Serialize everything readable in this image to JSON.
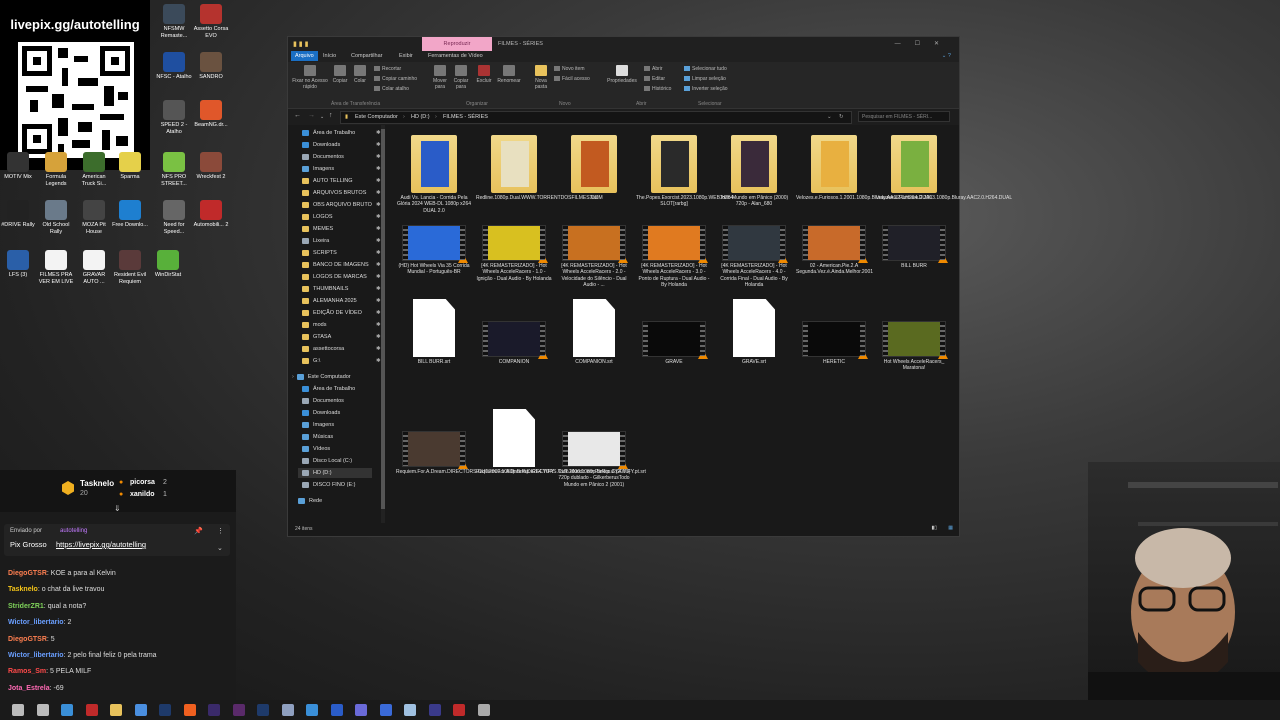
{
  "overlay": {
    "qr_title": "livepix.gg/autotelling"
  },
  "desktop_icons": [
    {
      "label": "NFSMW Remaste...",
      "color": "#3b4a5a"
    },
    {
      "label": "Assetto Corsa EVO",
      "color": "#b5332e"
    },
    {
      "label": "NFSC - Atalho",
      "color": "#1f4fa0"
    },
    {
      "label": "SANDRO",
      "color": "#6a5240"
    },
    {
      "label": "SPEED 2 - Atalho",
      "color": "#555"
    },
    {
      "label": "BeamNG.dr...",
      "color": "#e0572a"
    },
    {
      "label": "MOTIV Mix",
      "color": "#333"
    },
    {
      "label": "Formula Legends",
      "color": "#d6a23a"
    },
    {
      "label": "American Truck Si...",
      "color": "#3c6d2c"
    },
    {
      "label": "Sparma",
      "color": "#e5d04a"
    },
    {
      "label": "NFS PRO STREET...",
      "color": "#7ac143"
    },
    {
      "label": "Wreckfest 2",
      "color": "#8b4a3a"
    },
    {
      "label": "#DRIVE Rally",
      "color": "#222"
    },
    {
      "label": "Old School Rally",
      "color": "#6a7a8a"
    },
    {
      "label": "MOZA Pit House",
      "color": "#444"
    },
    {
      "label": "Free Downlo...",
      "color": "#1e7fd0"
    },
    {
      "label": "Need for Speed...",
      "color": "#666"
    },
    {
      "label": "Automobili... 2",
      "color": "#c02a2a"
    },
    {
      "label": "LFS (3)",
      "color": "#2a5fa8"
    },
    {
      "label": "FILMES PRA VER EM LIVE",
      "color": "#f3f3f3"
    },
    {
      "label": "GRAVAR AUTO ...",
      "color": "#f3f3f3"
    },
    {
      "label": "Resident Evil Requiem",
      "color": "#5a3a3a"
    },
    {
      "label": "WinDirStat",
      "color": "#58b03a"
    }
  ],
  "explorer": {
    "context_tab": "Reproduzir",
    "title": "FILMES - SÉRIES",
    "window_controls": [
      "—",
      "☐",
      "✕"
    ],
    "ribbon_tabs": [
      "Arquivo",
      "Início",
      "Compartilhar",
      "Exibir",
      "Ferramentas de Vídeo"
    ],
    "ribbon": {
      "pin": "Fixar no Acesso rápido",
      "copy": "Copiar",
      "paste": "Colar",
      "cut": "Recortar",
      "copy_path": "Copiar caminho",
      "paste_shortcut": "Colar atalho",
      "group_clipboard": "Área de Transferência",
      "move_to": "Mover para",
      "copy_to": "Copiar para",
      "delete": "Excluir",
      "rename": "Renomear",
      "group_organize": "Organizar",
      "new_folder": "Nova pasta",
      "new_item": "Novo item",
      "easy_access": "Fácil acesso",
      "group_new": "Novo",
      "properties": "Propriedades",
      "open": "Abrir",
      "edit": "Editar",
      "history": "Histórico",
      "group_open": "Abrir",
      "select_all": "Selecionar tudo",
      "select_none": "Limpar seleção",
      "invert": "Inverter seleção",
      "group_select": "Selecionar"
    },
    "breadcrumb": [
      "Este Computador",
      "HD (D:)",
      "FILMES - SÉRIES"
    ],
    "search_placeholder": "Pesquisar em FILMES - SÉRI...",
    "nav_items": [
      {
        "label": "Área de Trabalho",
        "color": "#3a8fd8",
        "pin": true
      },
      {
        "label": "Downloads",
        "color": "#3a8fd8",
        "pin": true
      },
      {
        "label": "Documentos",
        "color": "#9aa7b5",
        "pin": true
      },
      {
        "label": "Imagens",
        "color": "#5aa0d8",
        "pin": true
      },
      {
        "label": "AUTO TELLING",
        "color": "#e8c25c",
        "pin": true
      },
      {
        "label": "ARQUIVOS BRUTOS",
        "color": "#e8c25c",
        "pin": true
      },
      {
        "label": "OBS ARQUIVO BRUTO",
        "color": "#e8c25c",
        "pin": true
      },
      {
        "label": "LOGOS",
        "color": "#e8c25c",
        "pin": true
      },
      {
        "label": "MEMES",
        "color": "#e8c25c",
        "pin": true
      },
      {
        "label": "Lixeira",
        "color": "#9aa7b5",
        "pin": true
      },
      {
        "label": "SCRIPTS",
        "color": "#e8c25c",
        "pin": true
      },
      {
        "label": "BANCO DE IMAGENS",
        "color": "#e8c25c",
        "pin": true
      },
      {
        "label": "LOGOS DE MARCAS",
        "color": "#e8c25c",
        "pin": true
      },
      {
        "label": "THUMBNAILS",
        "color": "#e8c25c",
        "pin": true
      },
      {
        "label": "ALEMANHA 2025",
        "color": "#e8c25c",
        "pin": true
      },
      {
        "label": "EDIÇÃO DE VÍDEO",
        "color": "#e8c25c",
        "pin": true
      },
      {
        "label": "mods",
        "color": "#e8c25c",
        "pin": true
      },
      {
        "label": "GTASA",
        "color": "#e8c25c",
        "pin": true
      },
      {
        "label": "assettocorsa",
        "color": "#e8c25c",
        "pin": true
      },
      {
        "label": "G:\\",
        "color": "#e8c25c",
        "pin": true
      }
    ],
    "nav_pc": "Este Computador",
    "nav_pc_items": [
      {
        "label": "Área de Trabalho",
        "color": "#3a8fd8"
      },
      {
        "label": "Documentos",
        "color": "#9aa7b5"
      },
      {
        "label": "Downloads",
        "color": "#3a8fd8"
      },
      {
        "label": "Imagens",
        "color": "#5aa0d8"
      },
      {
        "label": "Músicas",
        "color": "#5aa0d8"
      },
      {
        "label": "Vídeos",
        "color": "#5aa0d8"
      },
      {
        "label": "Disco Local (C:)",
        "color": "#9aa7b5"
      },
      {
        "label": "HD (D:)",
        "color": "#9aa7b5"
      },
      {
        "label": "DISCO FINO (E:)",
        "color": "#9aa7b5"
      }
    ],
    "nav_network": "Rede",
    "items": [
      {
        "type": "folder",
        "name": "Audi Vs. Lancia - Corrida Pela Glória 2024 WEB-DL 1080p x264 DUAL 2.0",
        "color": "#2a5cc8"
      },
      {
        "type": "folder",
        "name": "Redline.1080p.Dual.WWW.TORRENTDOSFILMES.COM",
        "color": "#e8e0c0"
      },
      {
        "type": "folder",
        "name": "Taxi",
        "color": "#c25a20"
      },
      {
        "type": "folder",
        "name": "The.Popes.Exorcist.2023.1080p.WEB.H264-SLOT[rarbg]",
        "color": "#2a2a2a"
      },
      {
        "type": "folder",
        "name": "Todo Mundo em Pânico (2000) 720p - Alan_680",
        "color": "#3a2a3a"
      },
      {
        "type": "folder",
        "name": "Velozes.e.Furiosos.1.2001.1080p.Bluray.AAC2.0.H264.DUAL",
        "color": "#e8b040"
      },
      {
        "type": "folder",
        "name": "Velozes.e.Furiosos.2.2003.1080p.Bluray.AAC2.0.H264.DUAL",
        "color": "#7ab040"
      },
      {
        "type": "video",
        "name": "(HD) Hot Wheels Via 35 Corrida Mundial - Português-BR",
        "color": "#2a6ad8"
      },
      {
        "type": "video",
        "name": "[4K REMASTERIZADO] - Hot Wheels AcceleRacers - 1.0 - Ignição - Dual Audio - By Holanda",
        "color": "#d8c020"
      },
      {
        "type": "video",
        "name": "[4K REMASTERIZADO] - Hot Wheels AcceleRacers - 2.0 - Velocidade do Silêncio - Dual Audio - ...",
        "color": "#c87020"
      },
      {
        "type": "video",
        "name": "[4K REMASTERIZADO] - Hot Wheels AcceleRacers - 3.0 - Ponto de Ruptura - Dual Audio - By Holanda",
        "color": "#e07a20"
      },
      {
        "type": "video",
        "name": "[4K REMASTERIZADO] - Hot Wheels AcceleRacers - 4.0 - Corrida Final - Dual Audio - By Holanda",
        "color": "#303840"
      },
      {
        "type": "video",
        "name": "02 - American.Pie.2.A Segunda.Vez.é.Ainda.Melhor.2001",
        "color": "#c86a2a"
      },
      {
        "type": "video",
        "name": "BILL BURR",
        "color": "#202028"
      },
      {
        "type": "doc",
        "name": "BILL BURR.srt"
      },
      {
        "type": "video",
        "name": "COMPANION",
        "color": "#1a1a2a"
      },
      {
        "type": "doc",
        "name": "COMPANION.srt"
      },
      {
        "type": "video",
        "name": "GRAVE",
        "color": "#0a0a0a"
      },
      {
        "type": "doc",
        "name": "GRAVE.srt"
      },
      {
        "type": "video",
        "name": "HERETIC",
        "color": "#0a0a0a"
      },
      {
        "type": "video",
        "name": "Hot Wheels AcceleRacers_ Maratona!",
        "color": "#5a6a20"
      },
      {
        "type": "video",
        "name": "Requiem.For.A.Dream.DIRECTORS.CUT.2000.1080p.BrRip.x264.YIFY",
        "color": "#4a3a30"
      },
      {
        "type": "doc",
        "name": "Requiem.For.A.Dream.DIRECTORS.CUT.2000.1080p.BrRip.x264.YIFY.pt.srt"
      },
      {
        "type": "video",
        "name": "Todo Mundo em Panico 2 (2001) 720p dublado - GilkerberusTodo Mundo em Pânico 2 (2001)",
        "color": "#e8e8e8"
      }
    ],
    "status": "24 itens"
  },
  "stream_panel": {
    "user1": "Tasknelo",
    "user1_points": "20",
    "user2": "picorsa",
    "user2_points": "2",
    "user3": "xanildo",
    "user3_points": "1",
    "pinned_label": "Enviado por",
    "pinned_user": "autotelling",
    "pinned_text_prefix": "Pix Grosso",
    "pinned_link": "https://livepix.gg/autotelling",
    "chat": [
      {
        "user": "DiegoGTSR",
        "color": "#ff7f50",
        "text": "KOE a para al Kelvin"
      },
      {
        "user": "Tasknelo",
        "color": "#f5c518",
        "text": "o chat da live travou"
      },
      {
        "user": "StriderZR1",
        "color": "#7fd35a",
        "text": "qual a nota?"
      },
      {
        "user": "Wictor_libertario",
        "color": "#6a9fff",
        "text": "2"
      },
      {
        "user": "DiegoGTSR",
        "color": "#ff7f50",
        "text": "5"
      },
      {
        "user": "Wictor_libertario",
        "color": "#6a9fff",
        "text": "2 pelo final feliz 0 pela trama"
      },
      {
        "user": "Ramos_Sm",
        "color": "#ff4a4a",
        "text": "5 PELA MILF"
      },
      {
        "user": "Jota_Estrela",
        "color": "#ff69b4",
        "text": "-69"
      }
    ]
  }
}
